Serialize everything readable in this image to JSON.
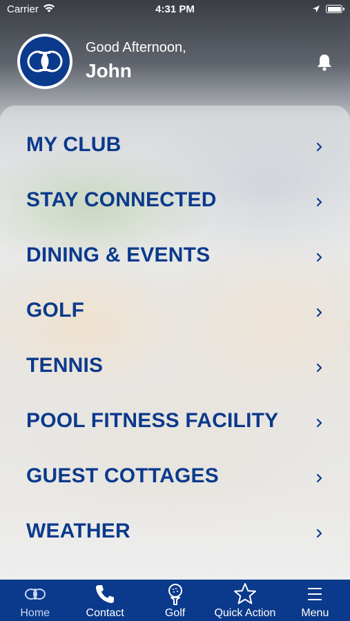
{
  "status_bar": {
    "carrier": "Carrier",
    "time": "4:31 PM"
  },
  "header": {
    "greeting": "Good Afternoon,",
    "user_name": "John"
  },
  "menu": {
    "items": [
      {
        "label": "MY CLUB"
      },
      {
        "label": "STAY CONNECTED"
      },
      {
        "label": "DINING & EVENTS"
      },
      {
        "label": "GOLF"
      },
      {
        "label": "TENNIS"
      },
      {
        "label": "POOL FITNESS FACILITY"
      },
      {
        "label": "GUEST COTTAGES"
      },
      {
        "label": "WEATHER"
      }
    ]
  },
  "tabbar": {
    "tabs": [
      {
        "label": "Home",
        "icon": "club-logo-icon",
        "active": true
      },
      {
        "label": "Contact",
        "icon": "phone-icon"
      },
      {
        "label": "Golf",
        "icon": "golf-ball-tee-icon"
      },
      {
        "label": "Quick Action",
        "icon": "star-icon"
      },
      {
        "label": "Menu",
        "icon": "hamburger-menu-icon"
      }
    ]
  },
  "colors": {
    "brand_blue": "#0b3a8c",
    "text_light": "#ffffff"
  }
}
